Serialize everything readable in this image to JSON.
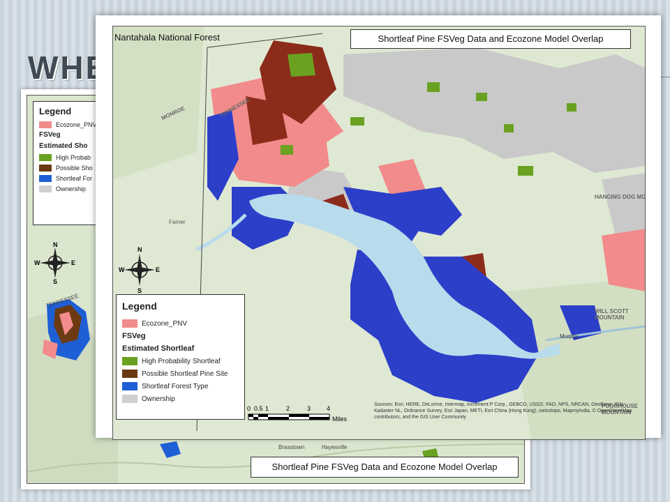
{
  "slide": {
    "title": "WHE"
  },
  "back_map": {
    "legend": {
      "heading": "Legend",
      "items": [
        {
          "label": "Ecozone_PNV",
          "color": "#f28b8b"
        },
        {
          "label": "FSVeg",
          "bold": true
        },
        {
          "label": "Estimated Sho",
          "bold": true
        },
        {
          "label": "High Probab",
          "color": "#6aa121"
        },
        {
          "label": "Possible Sho",
          "color": "#6b3a12"
        },
        {
          "label": "Shortleaf For",
          "color": "#1f5fd6"
        },
        {
          "label": "Ownership",
          "color": "#cfcfcf"
        }
      ]
    },
    "title": "Shortleaf Pine FSVeg Data and Ecozone Model Overlap",
    "places": [
      "TENNESSEE",
      "Brasstown",
      "Hayesville"
    ]
  },
  "front_map": {
    "region_label": "Nantahala National Forest",
    "title": "Shortleaf Pine FSVeg Data and Ecozone Model Overlap",
    "legend": {
      "heading": "Legend",
      "items": [
        {
          "label": "Ecozone_PNV",
          "color": "#f28b8b"
        },
        {
          "label": "FSVeg",
          "bold": true
        },
        {
          "label": "Estimated Shortleaf",
          "bold": true
        },
        {
          "label": "High Probability Shortleaf",
          "color": "#6aa121"
        },
        {
          "label": "Possible Shortleaf Pine Site",
          "color": "#6b3a12"
        },
        {
          "label": "Shortleaf Forest Type",
          "color": "#1f5fd6"
        },
        {
          "label": "Ownership",
          "color": "#cfcfcf"
        }
      ]
    },
    "compass": {
      "n": "N",
      "s": "S",
      "e": "E",
      "w": "W"
    },
    "scale": {
      "ticks": [
        "0",
        "0.5",
        "1",
        "2",
        "3",
        "4"
      ],
      "unit": "Miles"
    },
    "sources": "Sources: Esri, HERE, DeLorme, Intermap, increment P Corp., GEBCO, USGS, FAO, NPS, NRCAN, GeoBase, IGN, Kadaster NL, Ordnance Survey, Esri Japan, METI, Esri China (Hong Kong), swisstopo, MapmyIndia, © OpenStreetMap contributors, and the GIS User Community",
    "places": [
      "TENNESSEE",
      "MONROE",
      "HANGING DOG MOUNTAIN",
      "WILL SCOTT MOUNTAIN",
      "Murphy",
      "Farner",
      "POORHOUSE MOUNTAIN"
    ]
  }
}
